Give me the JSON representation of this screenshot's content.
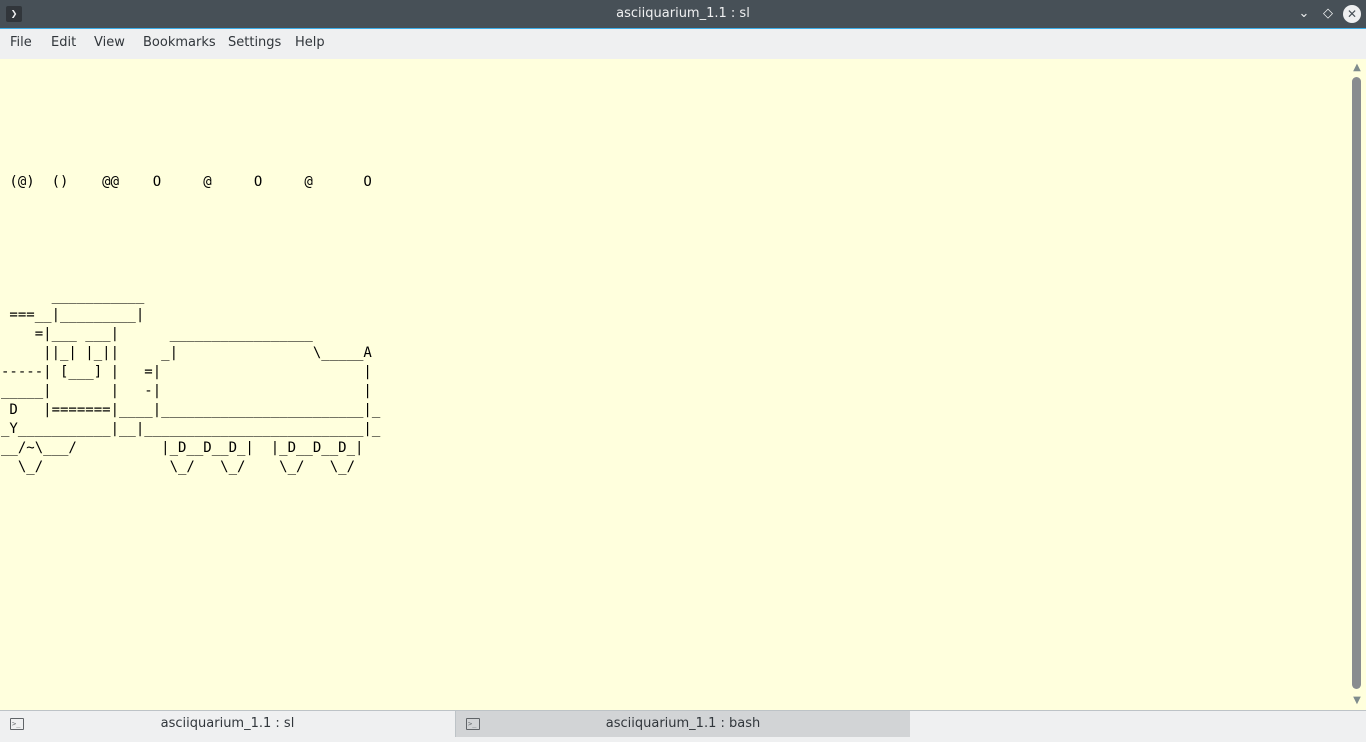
{
  "window": {
    "title": "asciiquarium_1.1 : sl",
    "app_icon_glyph": "❯",
    "minimize_glyph": "⌄",
    "maximize_glyph": "◇",
    "close_glyph": "✕"
  },
  "menubar": {
    "items": [
      "File",
      "Edit",
      "View",
      "Bookmarks",
      "Settings",
      "Help"
    ]
  },
  "terminal": {
    "background": "#ffffdd",
    "lines": [
      "",
      "",
      "",
      "",
      "",
      "",
      " (@)  ()    @@    O     @     O     @      O",
      "",
      "",
      "",
      "",
      "",
      "      ___________",
      " ===__|_________|",
      "    =|___ ___|      _________________",
      "     ||_| |_||     _|                \\_____A",
      "-----| [___] |   =|                        |",
      "_____|       |   -|                        |",
      " D   |=======|____|________________________|_",
      "_Y___________|__|__________________________|_",
      "__/~\\___/          |_D__D__D_|  |_D__D__D_|",
      "  \\_/               \\_/   \\_/    \\_/   \\_/"
    ]
  },
  "scrollbar": {
    "up_glyph": "▲",
    "down_glyph": "▼"
  },
  "tabs": [
    {
      "label": "asciiquarium_1.1 : sl",
      "icon_glyph": ">_",
      "active": true
    },
    {
      "label": "asciiquarium_1.1 : bash",
      "icon_glyph": ">_",
      "active": false
    }
  ],
  "colors": {
    "titlebar": "#475057",
    "accent": "#3daee9",
    "terminal_bg": "#ffffdd"
  }
}
